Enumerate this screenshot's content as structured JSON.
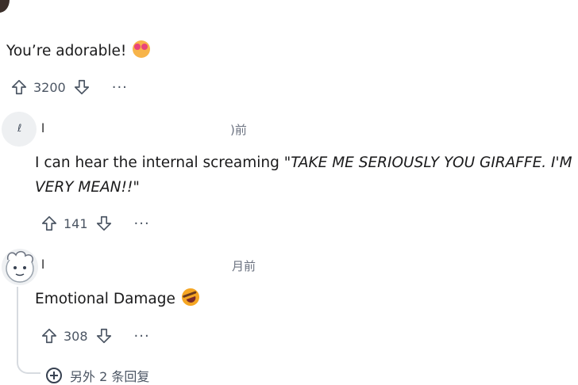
{
  "comments": [
    {
      "text": "You’re adorable!",
      "emoji": "smiling-face-with-hearts-icon",
      "votes": "3200",
      "more": "···"
    },
    {
      "author": "l",
      "time_suffix": ")前",
      "text_prefix": "I can hear the internal screaming \"",
      "text_emph": "TAKE ME SERIOUSLY YOU GIRAFFE. I'M",
      "text_line2_emph": "VERY MEAN!!",
      "text_line2_suffix": "\"",
      "votes": "141",
      "more": "···"
    },
    {
      "author": "l",
      "time_suffix": "月前",
      "text": "Emotional Damage",
      "emoji": "rolling-laughing-face-icon",
      "votes": "308",
      "more": "···"
    }
  ],
  "more_replies": "另外 2 条回复",
  "colors": {
    "text": "#1a1a1b",
    "muted": "#6b7280",
    "icon": "#4b5563",
    "thread": "#d7dbe0"
  }
}
